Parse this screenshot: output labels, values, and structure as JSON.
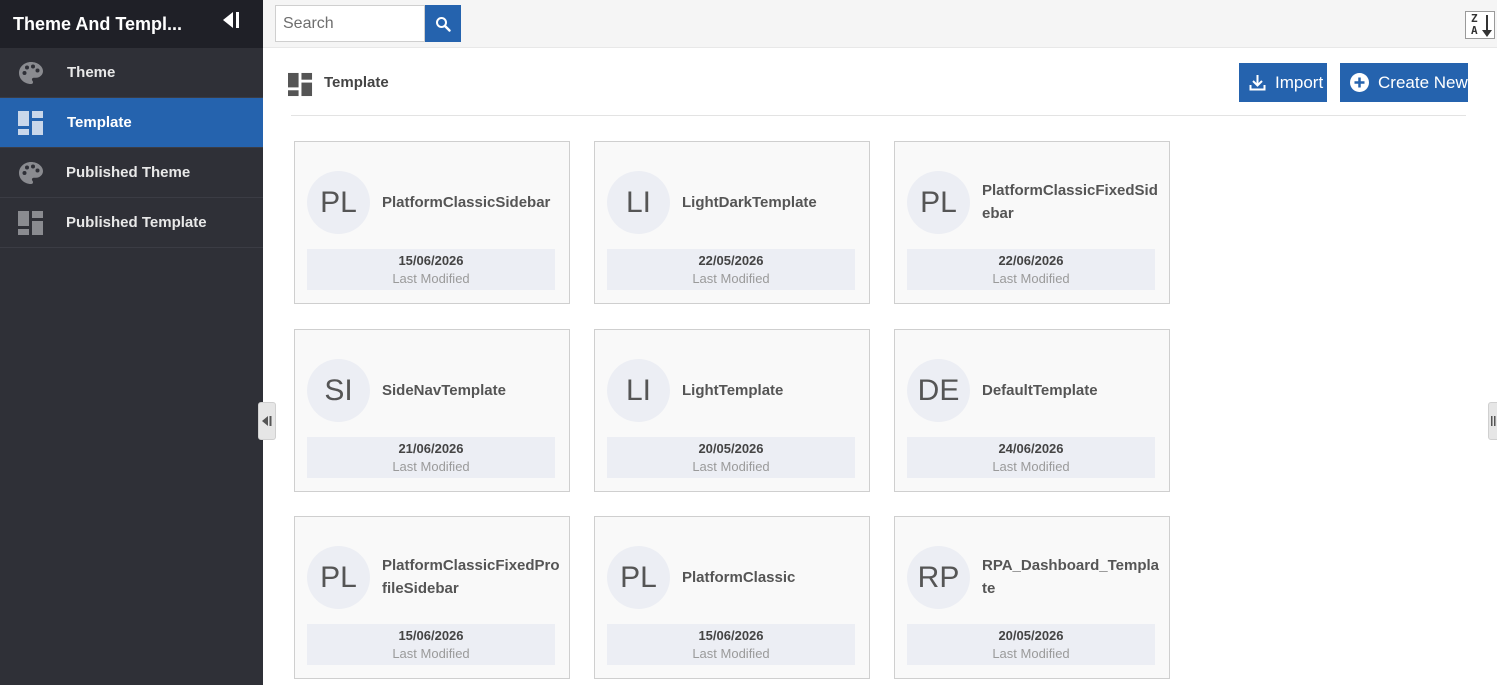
{
  "app": {
    "title": "Theme And Templ..."
  },
  "sidebar": {
    "items": [
      {
        "label": "Theme",
        "icon": "palette-icon"
      },
      {
        "label": "Template",
        "icon": "template-icon",
        "active": true
      },
      {
        "label": "Published Theme",
        "icon": "palette-icon"
      },
      {
        "label": "Published Template",
        "icon": "template-icon"
      }
    ]
  },
  "topbar": {
    "search": {
      "placeholder": "Search",
      "value": ""
    }
  },
  "page": {
    "title": "Template",
    "import_label": "Import",
    "create_label": "Create New"
  },
  "templates": [
    {
      "initials": "PL",
      "name": "PlatformClassicSidebar",
      "date": "15/06/2026",
      "modified_label": "Last Modified"
    },
    {
      "initials": "LI",
      "name": "LightDarkTemplate",
      "date": "22/05/2026",
      "modified_label": "Last Modified"
    },
    {
      "initials": "PL",
      "name": "PlatformClassicFixedSidebar",
      "date": "22/06/2026",
      "modified_label": "Last Modified"
    },
    {
      "initials": "SI",
      "name": "SideNavTemplate",
      "date": "21/06/2026",
      "modified_label": "Last Modified"
    },
    {
      "initials": "LI",
      "name": "LightTemplate",
      "date": "20/05/2026",
      "modified_label": "Last Modified"
    },
    {
      "initials": "DE",
      "name": "DefaultTemplate",
      "date": "24/06/2026",
      "modified_label": "Last Modified"
    },
    {
      "initials": "PL",
      "name": "PlatformClassicFixedProfileSidebar",
      "date": "15/06/2026",
      "modified_label": "Last Modified"
    },
    {
      "initials": "PL",
      "name": "PlatformClassic",
      "date": "15/06/2026",
      "modified_label": "Last Modified"
    },
    {
      "initials": "RP",
      "name": "RPA_Dashboard_Template",
      "date": "20/05/2026",
      "modified_label": "Last Modified"
    }
  ],
  "colors": {
    "accent": "#2563ae",
    "sidebar_bg": "#2f3037",
    "sidebar_header_bg": "#1f2027"
  }
}
